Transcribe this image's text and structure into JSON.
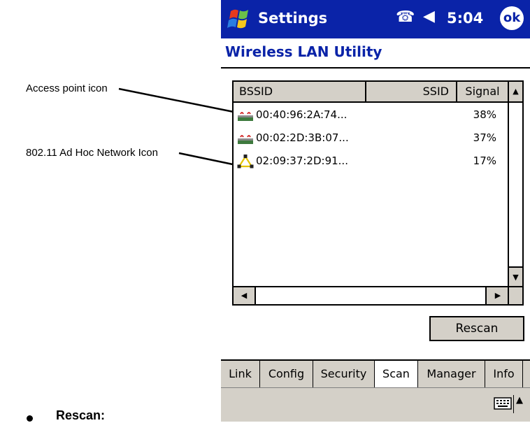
{
  "annotations": {
    "access_point_label": "Access point icon",
    "adhoc_label": "802.11 Ad Hoc Network Icon"
  },
  "titlebar": {
    "title": "Settings",
    "time": "5:04",
    "ok_label": "ok",
    "start_icon": "windows-flag-icon",
    "connectivity_icon": "connectivity-icon",
    "speaker_icon": "speaker-icon",
    "color": "#0a23a8"
  },
  "app": {
    "heading": "Wireless LAN Utility"
  },
  "list": {
    "columns": [
      "BSSID",
      "SSID",
      "Signal"
    ],
    "rows": [
      {
        "bssid": "00:40:96:2A:74...",
        "ssid": "",
        "signal": "38%",
        "icon": "access-point-icon"
      },
      {
        "bssid": "00:02:2D:3B:07...",
        "ssid": "",
        "signal": "37%",
        "icon": "access-point-icon"
      },
      {
        "bssid": "02:09:37:2D:91...",
        "ssid": "",
        "signal": "17%",
        "icon": "adhoc-network-icon"
      }
    ]
  },
  "buttons": {
    "rescan": "Rescan"
  },
  "tabs": [
    "Link",
    "Config",
    "Security",
    "Scan",
    "Manager",
    "Info"
  ],
  "active_tab": "Scan",
  "doc": {
    "section_heading": "Rescan:"
  }
}
